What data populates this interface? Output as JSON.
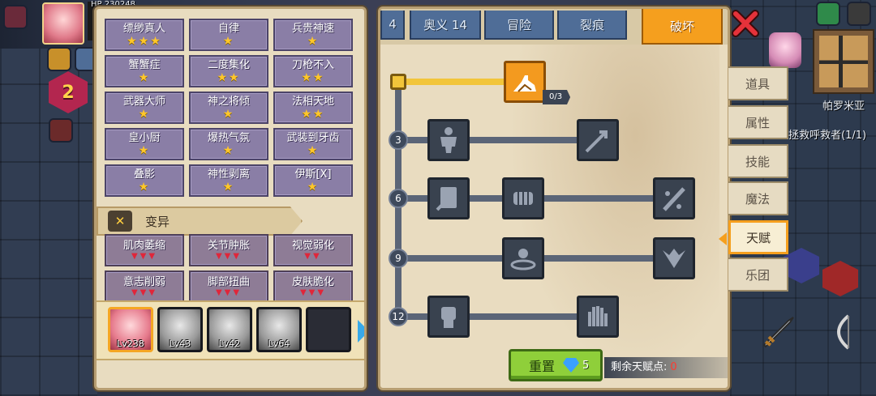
{
  "hud": {
    "hp_label": "HP",
    "hp_value": "230248",
    "level": "2"
  },
  "world": {
    "place_name": "帕罗米亚",
    "quest_text": "拯救呼救者(1/1)"
  },
  "traits": [
    {
      "name": "缥缈真人",
      "stars": "★★★"
    },
    {
      "name": "自律",
      "stars": "★"
    },
    {
      "name": "兵贵神速",
      "stars": "★"
    },
    {
      "name": "蟹蟹症",
      "stars": "★"
    },
    {
      "name": "二度集化",
      "stars": "★★"
    },
    {
      "name": "刀枪不入",
      "stars": "★★"
    },
    {
      "name": "武器大师",
      "stars": "★"
    },
    {
      "name": "神之将倾",
      "stars": "★"
    },
    {
      "name": "法相天地",
      "stars": "★★"
    },
    {
      "name": "皇小厨",
      "stars": "★"
    },
    {
      "name": "爆热气氛",
      "stars": "★"
    },
    {
      "name": "武装到牙齿",
      "stars": "★"
    },
    {
      "name": "叠影",
      "stars": "★"
    },
    {
      "name": "神性剥离",
      "stars": "★"
    },
    {
      "name": "伊斯[X]",
      "stars": "★"
    }
  ],
  "mutation_section": {
    "title": "变异",
    "items": [
      {
        "name": "肌肉萎缩",
        "marks": "▼▼▼"
      },
      {
        "name": "关节肿胀",
        "marks": "▼▼▼"
      },
      {
        "name": "视觉弱化",
        "marks": "▼▼"
      },
      {
        "name": "意志削弱",
        "marks": "▼▼▼"
      },
      {
        "name": "脚部扭曲",
        "marks": "▼▼▼"
      },
      {
        "name": "皮肤脆化",
        "marks": "▼▼▼"
      }
    ]
  },
  "party": [
    {
      "level": "Lv238",
      "selected": true
    },
    {
      "level": "Lv43",
      "selected": false
    },
    {
      "level": "Lv42",
      "selected": false
    },
    {
      "level": "Lv64",
      "selected": false
    },
    {
      "level": "",
      "selected": false
    }
  ],
  "tabs": [
    {
      "label": "4"
    },
    {
      "label": "奥义 14"
    },
    {
      "label": "冒险"
    },
    {
      "label": "裂痕"
    },
    {
      "label": "破坏",
      "active": true
    }
  ],
  "talent_tree": {
    "root_count": "0/3",
    "row_numbers": [
      "3",
      "6",
      "9",
      "12"
    ],
    "nodes": [
      {
        "row": "3",
        "icon": "body-icon"
      },
      {
        "row": "3",
        "icon": "arrow-strike-icon"
      },
      {
        "row": "6",
        "icon": "shield-card-icon"
      },
      {
        "row": "6",
        "icon": "fist-punch-icon"
      },
      {
        "row": "6",
        "icon": "blade-splash-icon"
      },
      {
        "row": "9",
        "icon": "ground-pound-icon"
      },
      {
        "row": "9",
        "icon": "demon-wings-icon"
      },
      {
        "row": "12",
        "icon": "raised-fist-icon"
      },
      {
        "row": "12",
        "icon": "open-palm-icon"
      }
    ]
  },
  "reset": {
    "label": "重置",
    "cost": "5"
  },
  "points": {
    "label": "剩余天赋点:",
    "value": "0"
  },
  "side_menu": [
    {
      "label": "道具"
    },
    {
      "label": "属性"
    },
    {
      "label": "技能"
    },
    {
      "label": "魔法"
    },
    {
      "label": "天赋",
      "active": true
    },
    {
      "label": "乐团"
    }
  ],
  "colors": {
    "accent": "#f59f1e",
    "tab_blue": "#4f6d97",
    "reset_green": "#8fcf3a",
    "points_red": "#ff3b30"
  }
}
